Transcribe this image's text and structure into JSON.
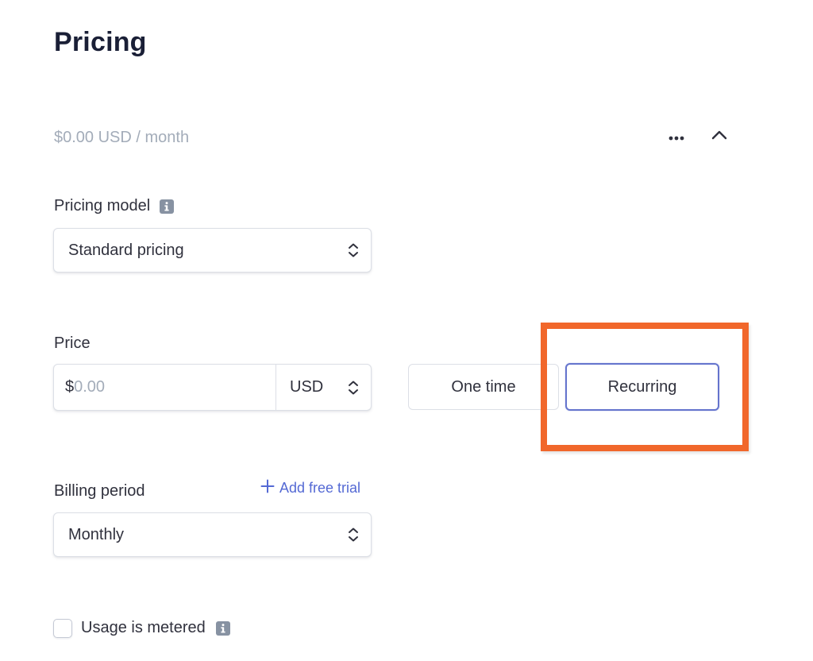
{
  "page": {
    "title": "Pricing"
  },
  "summary": {
    "price_text": "$0.00 USD / month"
  },
  "header_actions": {
    "more_icon": "more-horizontal-icon",
    "collapse_icon": "chevron-up-icon"
  },
  "pricing_model": {
    "label": "Pricing model",
    "info_icon": "info-icon",
    "value": "Standard pricing"
  },
  "price": {
    "label": "Price",
    "currency_symbol": "$",
    "amount_placeholder": "0.00",
    "amount_value": "",
    "currency": "USD"
  },
  "price_type": {
    "options": [
      "One time",
      "Recurring"
    ],
    "selected": "Recurring"
  },
  "billing_period": {
    "label": "Billing period",
    "add_free_trial": "Add free trial",
    "value": "Monthly"
  },
  "metered": {
    "label": "Usage is metered",
    "checked": false,
    "info_icon": "info-icon"
  },
  "colors": {
    "accent": "#5469d4",
    "selected_border": "#6574cd",
    "highlight": "#f1672b",
    "muted_text": "#a3acb9",
    "title_text": "#1a1f36"
  }
}
